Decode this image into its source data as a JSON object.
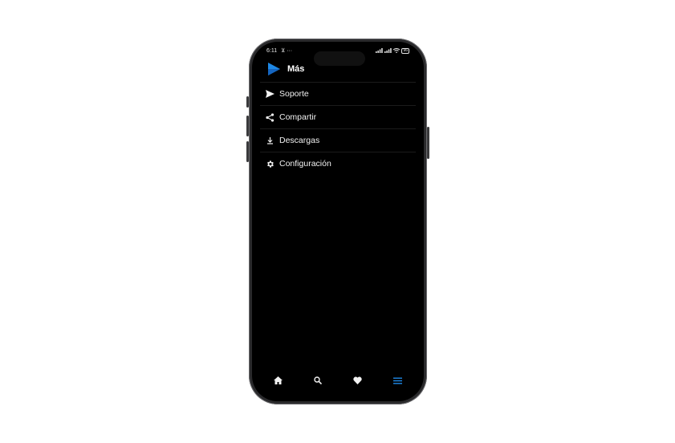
{
  "status": {
    "time": "6:11",
    "extra": "⊻ ···",
    "battery": "96"
  },
  "header": {
    "title": "Más"
  },
  "menu": {
    "items": [
      {
        "label": "Soporte",
        "icon": "send-icon"
      },
      {
        "label": "Compartir",
        "icon": "share-icon"
      },
      {
        "label": "Descargas",
        "icon": "download-icon"
      },
      {
        "label": "Configuración",
        "icon": "gear-icon"
      }
    ]
  },
  "nav": {
    "items": [
      {
        "icon": "home-icon"
      },
      {
        "icon": "search-icon"
      },
      {
        "icon": "heart-icon"
      },
      {
        "icon": "menu-icon",
        "active": true
      }
    ]
  },
  "colors": {
    "accent": "#1e88e5",
    "background": "#000000",
    "text": "#f2f2f2"
  }
}
